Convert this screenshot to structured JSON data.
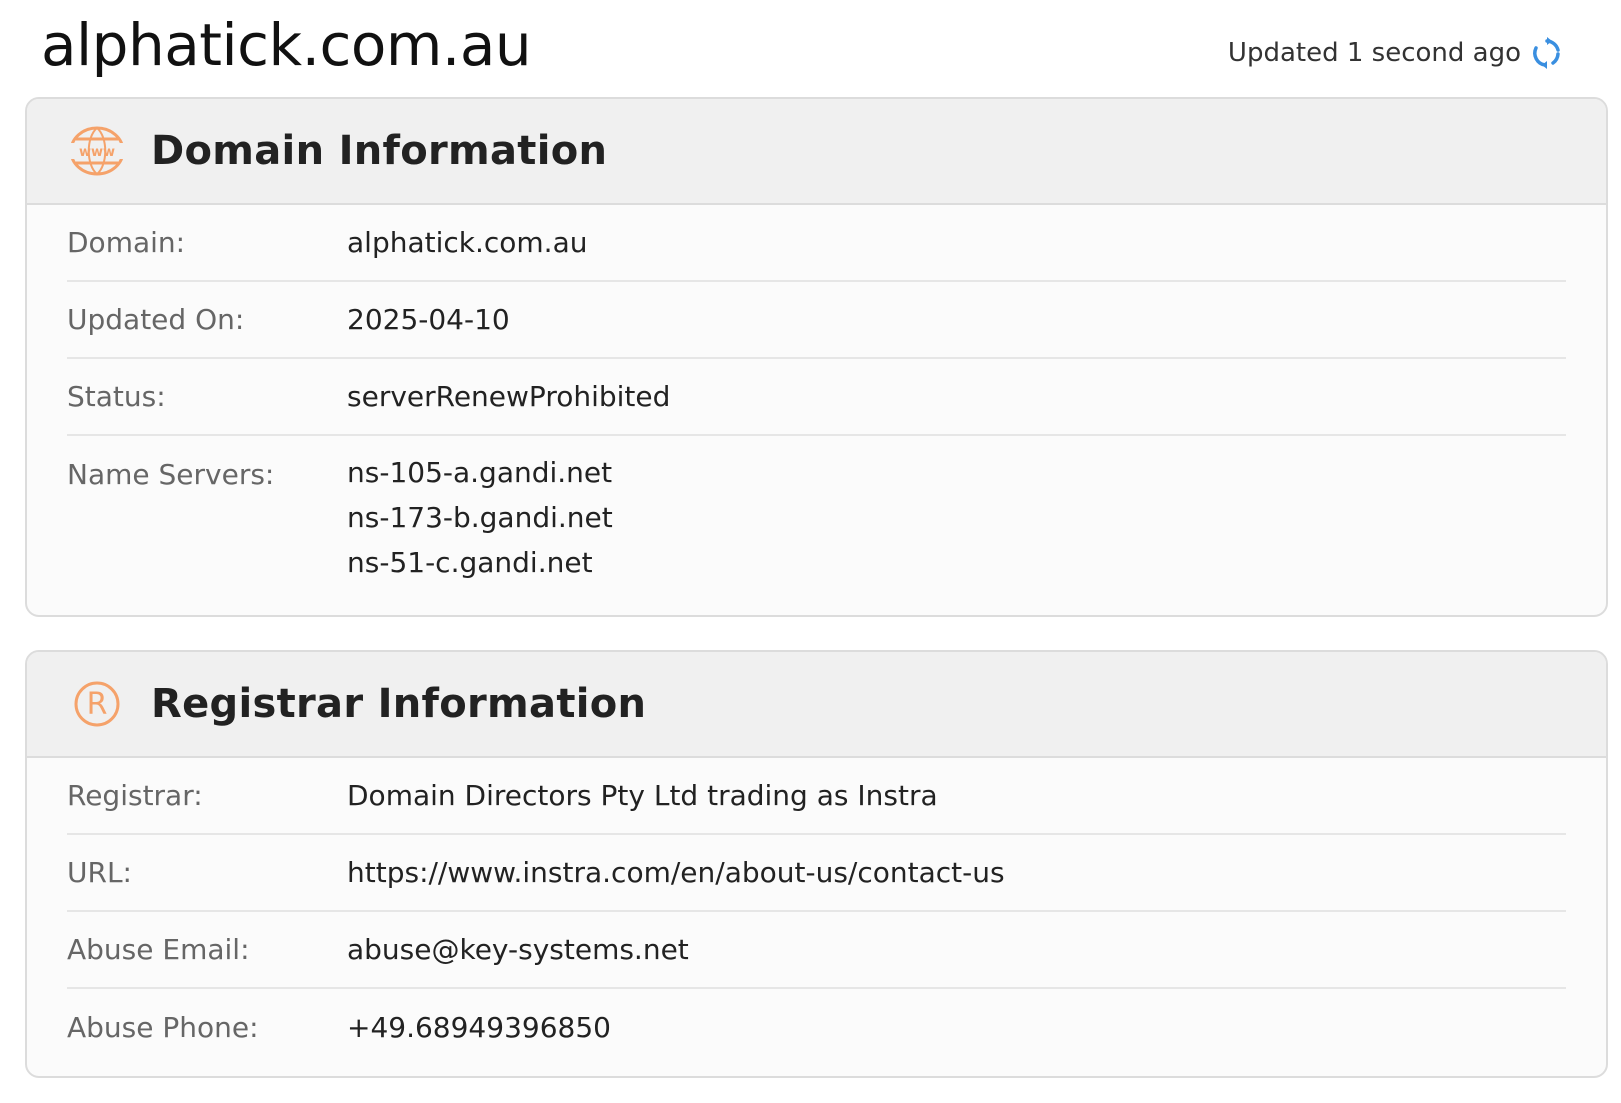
{
  "page": {
    "title": "alphatick.com.au",
    "updated_text": "Updated 1 second ago"
  },
  "colors": {
    "accent_orange": "#f5a26a",
    "refresh_blue": "#3a8fe0"
  },
  "domain_info": {
    "title": "Domain Information",
    "icon": "www-globe-icon",
    "rows": [
      {
        "label": "Domain:",
        "value": "alphatick.com.au"
      },
      {
        "label": "Updated On:",
        "value": "2025-04-10"
      },
      {
        "label": "Status:",
        "value": "serverRenewProhibited"
      }
    ],
    "name_servers": {
      "label": "Name Servers:",
      "values": [
        "ns-105-a.gandi.net",
        "ns-173-b.gandi.net",
        "ns-51-c.gandi.net"
      ]
    }
  },
  "registrar_info": {
    "title": "Registrar Information",
    "icon": "registered-mark-icon",
    "rows": [
      {
        "label": "Registrar:",
        "value": "Domain Directors Pty Ltd trading as Instra"
      },
      {
        "label": "URL:",
        "value": "https://www.instra.com/en/about-us/contact-us"
      },
      {
        "label": "Abuse Email:",
        "value": "abuse@key-systems.net"
      },
      {
        "label": "Abuse Phone:",
        "value": "+49.68949396850"
      }
    ]
  }
}
